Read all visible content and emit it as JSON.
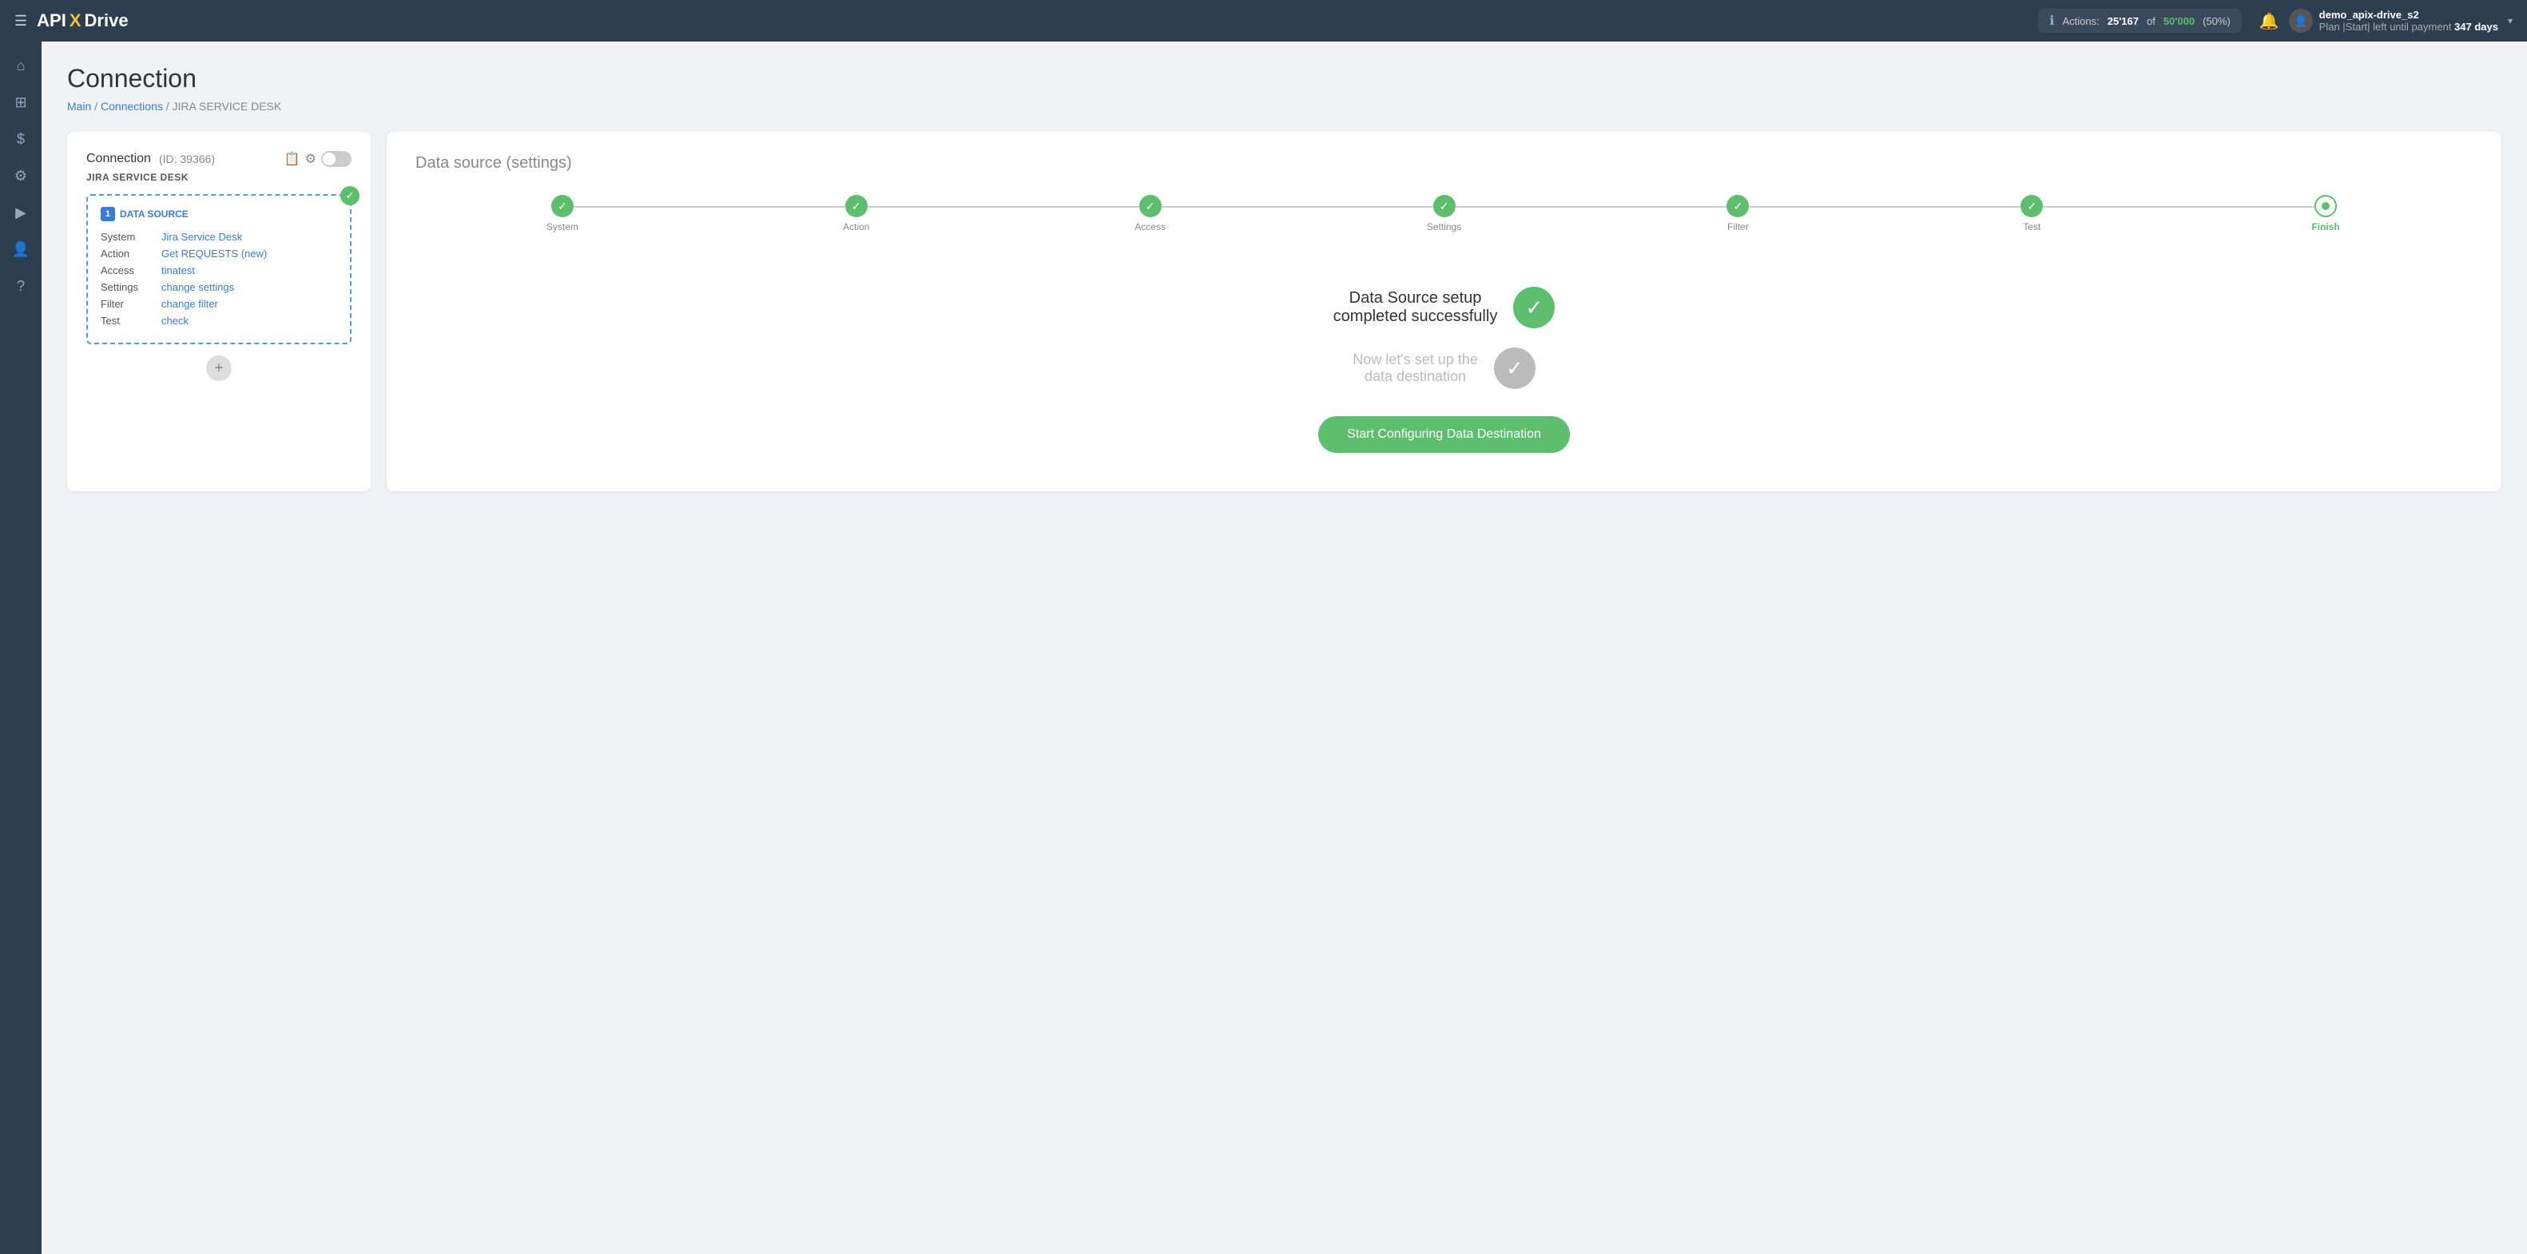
{
  "topnav": {
    "logo": {
      "api": "API",
      "x": "X",
      "drive": "Drive"
    },
    "actions": {
      "label": "Actions:",
      "current": "25'167",
      "of_text": "of",
      "total": "50'000",
      "pct": "(50%)"
    },
    "bell_label": "notifications",
    "user": {
      "name": "demo_apix-drive_s2",
      "plan_text": "Plan |Start| left until payment",
      "days": "347 days"
    },
    "chevron": "▾"
  },
  "sidebar": {
    "items": [
      {
        "icon": "☰",
        "name": "menu-icon"
      },
      {
        "icon": "⌂",
        "name": "home-icon"
      },
      {
        "icon": "⊞",
        "name": "grid-icon"
      },
      {
        "icon": "$",
        "name": "billing-icon"
      },
      {
        "icon": "🧰",
        "name": "tools-icon"
      },
      {
        "icon": "▶",
        "name": "play-icon"
      },
      {
        "icon": "👤",
        "name": "user-icon"
      },
      {
        "icon": "?",
        "name": "help-icon"
      }
    ]
  },
  "page": {
    "title": "Connection",
    "breadcrumb": {
      "main": "Main",
      "connections": "Connections",
      "current": "JIRA SERVICE DESK"
    }
  },
  "left_card": {
    "title": "Connection",
    "id_text": "(ID: 39366)",
    "subtitle": "JIRA SERVICE DESK",
    "datasource": {
      "badge_num": "1",
      "badge_label": "DATA SOURCE",
      "rows": [
        {
          "key": "System",
          "value": "Jira Service Desk"
        },
        {
          "key": "Action",
          "value": "Get REQUESTS (new)"
        },
        {
          "key": "Access",
          "value": "tinatest"
        },
        {
          "key": "Settings",
          "value": "change settings"
        },
        {
          "key": "Filter",
          "value": "change filter"
        },
        {
          "key": "Test",
          "value": "check"
        }
      ]
    },
    "add_btn_label": "+"
  },
  "right_card": {
    "title": "Data source",
    "title_settings": "(settings)",
    "steps": [
      {
        "label": "System",
        "state": "done"
      },
      {
        "label": "Action",
        "state": "done"
      },
      {
        "label": "Access",
        "state": "done"
      },
      {
        "label": "Settings",
        "state": "done"
      },
      {
        "label": "Filter",
        "state": "done"
      },
      {
        "label": "Test",
        "state": "done"
      },
      {
        "label": "Finish",
        "state": "active"
      }
    ],
    "success_primary": "Data Source setup\ncompleted successfully",
    "success_secondary": "Now let's set up the\ndata destination",
    "cta_button": "Start Configuring Data Destination"
  }
}
